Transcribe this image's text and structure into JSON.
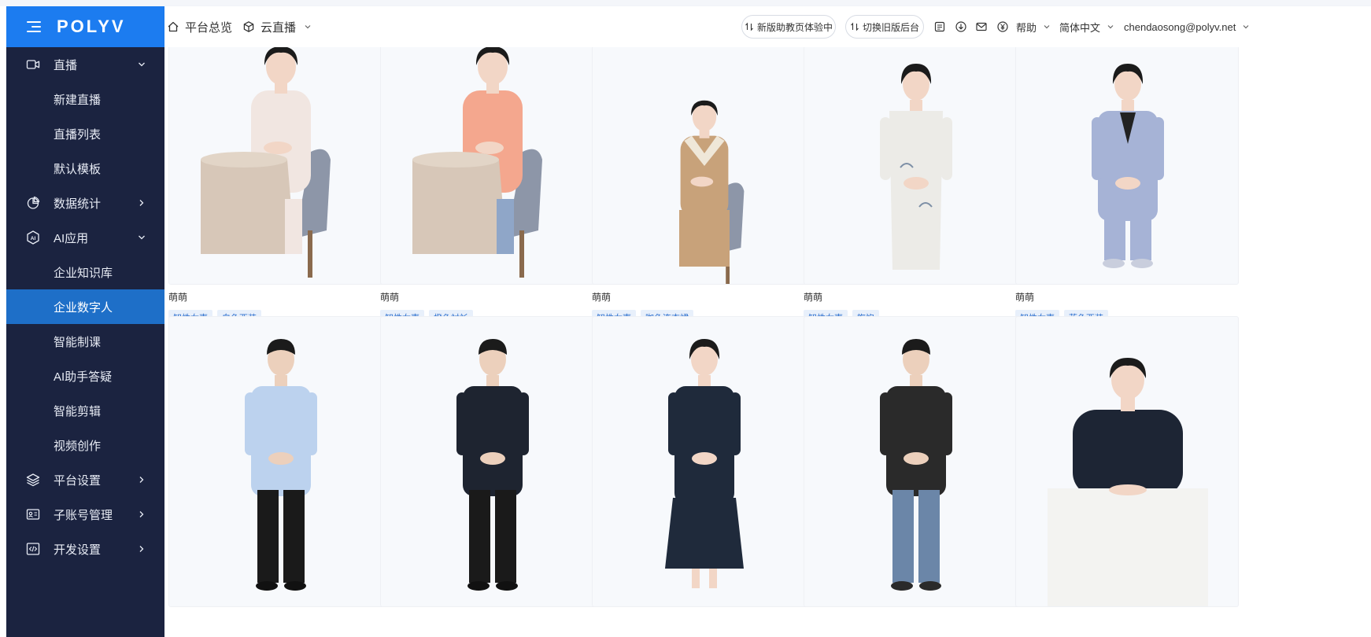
{
  "app": {
    "logo": "POLYV"
  },
  "sidebar": {
    "items": [
      {
        "label": "直播",
        "level": "top",
        "icon": "video-camera-icon",
        "arrow": "down"
      },
      {
        "label": "新建直播",
        "level": "sub"
      },
      {
        "label": "直播列表",
        "level": "sub"
      },
      {
        "label": "默认模板",
        "level": "sub"
      },
      {
        "label": "数据统计",
        "level": "top",
        "icon": "pie-chart-icon",
        "arrow": "right"
      },
      {
        "label": "AI应用",
        "level": "top",
        "icon": "ai-hexagon-icon",
        "arrow": "down"
      },
      {
        "label": "企业知识库",
        "level": "sub"
      },
      {
        "label": "企业数字人",
        "level": "sub",
        "active": true
      },
      {
        "label": "智能制课",
        "level": "sub"
      },
      {
        "label": "AI助手答疑",
        "level": "sub"
      },
      {
        "label": "智能剪辑",
        "level": "sub"
      },
      {
        "label": "视频创作",
        "level": "sub"
      },
      {
        "label": "平台设置",
        "level": "top",
        "icon": "layers-icon",
        "arrow": "right"
      },
      {
        "label": "子账号管理",
        "level": "top",
        "icon": "id-card-icon",
        "arrow": "right"
      },
      {
        "label": "开发设置",
        "level": "top",
        "icon": "code-icon",
        "arrow": "right"
      }
    ]
  },
  "header": {
    "home_label": "平台总览",
    "cloud_label": "云直播",
    "new_assistant_label": "新版助教页体验中",
    "switch_old_label": "切换旧版后台",
    "help_label": "帮助",
    "language_label": "简体中文",
    "user_email": "chendaosong@polyv.net"
  },
  "avatars": [
    {
      "name": "萌萌",
      "tags": [
        "知性女声",
        "白色西装"
      ]
    },
    {
      "name": "萌萌",
      "tags": [
        "知性女声",
        "橙色衬衫"
      ]
    },
    {
      "name": "萌萌",
      "tags": [
        "知性女声",
        "咖色连衣裙"
      ]
    },
    {
      "name": "萌萌",
      "tags": [
        "知性女声",
        "旗袍"
      ]
    },
    {
      "name": "萌萌",
      "tags": [
        "知性女声",
        "蓝色西装"
      ]
    },
    {
      "name": "",
      "tags": []
    },
    {
      "name": "",
      "tags": []
    },
    {
      "name": "",
      "tags": []
    },
    {
      "name": "",
      "tags": []
    },
    {
      "name": "",
      "tags": []
    }
  ],
  "colors": {
    "brand": "#1c7cf0",
    "sidebar": "#1b2340",
    "active": "#1e6fc8",
    "tag_bg": "#e8f0fb",
    "tag_text": "#2d6fce"
  }
}
